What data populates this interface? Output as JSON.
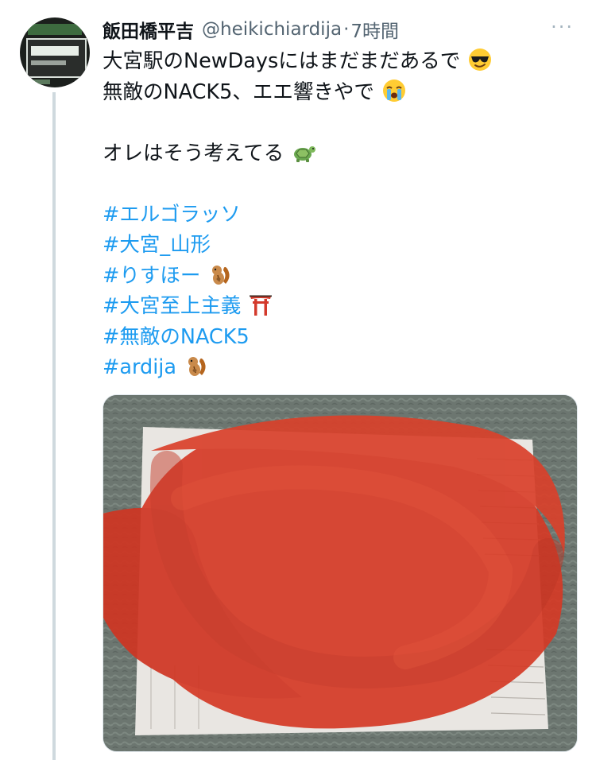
{
  "author": {
    "display_name": "飯田橋平吉",
    "handle": "@heikichiardija",
    "separator": "·",
    "time": "7時間"
  },
  "more_menu": "···",
  "tweet": {
    "line1": "大宮駅のNewDaysにはまだまだあるで",
    "line2": "無敵のNACK5、エエ響きやで",
    "line3": "オレはそう考えてる",
    "hashtags": [
      "#エルゴラッソ",
      "#大宮_山形",
      "#りすほー",
      "#大宮至上主義",
      "#無敵のNACK5",
      "#ardija"
    ]
  },
  "icons": {
    "line1_emoji": "sunglasses-face-icon",
    "line2_emoji": "crying-face-icon",
    "line3_emoji": "turtle-icon",
    "squirrel": "chipmunk-icon",
    "shrine": "torii-gate-icon"
  },
  "colors": {
    "hashtag": "#1d9bf0",
    "secondary_text": "#536471",
    "thread_line": "#cfd9de",
    "scribble_red": "#d53a26"
  }
}
